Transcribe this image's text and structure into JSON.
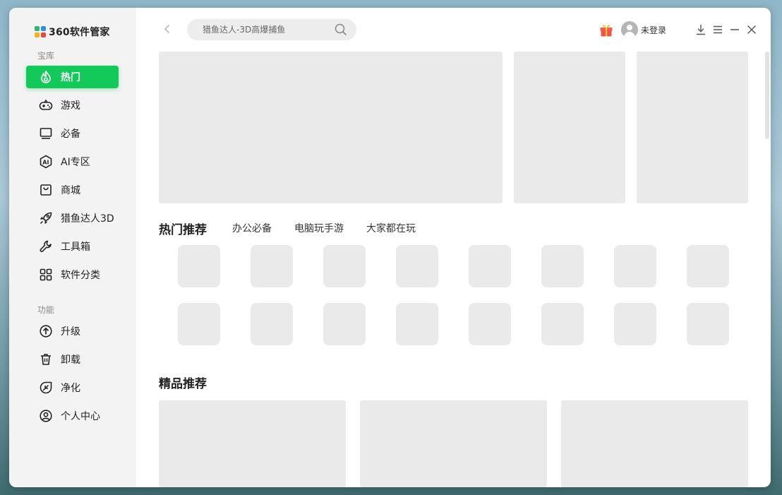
{
  "app": {
    "title": "360软件管家",
    "brand_colors": [
      "#33b56a",
      "#2f8fe0",
      "#f2b01e",
      "#e8473d"
    ]
  },
  "sidebar": {
    "section1_label": "宝库",
    "section2_label": "功能",
    "items": [
      {
        "label": "热门",
        "icon": "flame-icon",
        "active": true
      },
      {
        "label": "游戏",
        "icon": "gamepad-icon"
      },
      {
        "label": "必备",
        "icon": "monitor-icon"
      },
      {
        "label": "AI专区",
        "icon": "ai-hexagon-icon"
      },
      {
        "label": "商城",
        "icon": "shopping-bag-icon"
      },
      {
        "label": "猎鱼达人3D",
        "icon": "rocket-icon"
      },
      {
        "label": "工具箱",
        "icon": "wrench-icon"
      },
      {
        "label": "软件分类",
        "icon": "grid-icon"
      },
      {
        "label": "升级",
        "icon": "upgrade-arrow-icon"
      },
      {
        "label": "卸载",
        "icon": "trash-icon"
      },
      {
        "label": "净化",
        "icon": "leaf-shield-icon"
      },
      {
        "label": "个人中心",
        "icon": "user-circle-icon"
      }
    ],
    "accent_color": "#12c95a"
  },
  "header": {
    "search_placeholder": "猎鱼达人-3D高爆捕鱼",
    "login_text": "未登录"
  },
  "sections": {
    "hot_title": "热门推荐",
    "tabs": [
      "办公必备",
      "电脑玩手游",
      "大家都在玩"
    ],
    "featured_title": "精品推荐"
  }
}
